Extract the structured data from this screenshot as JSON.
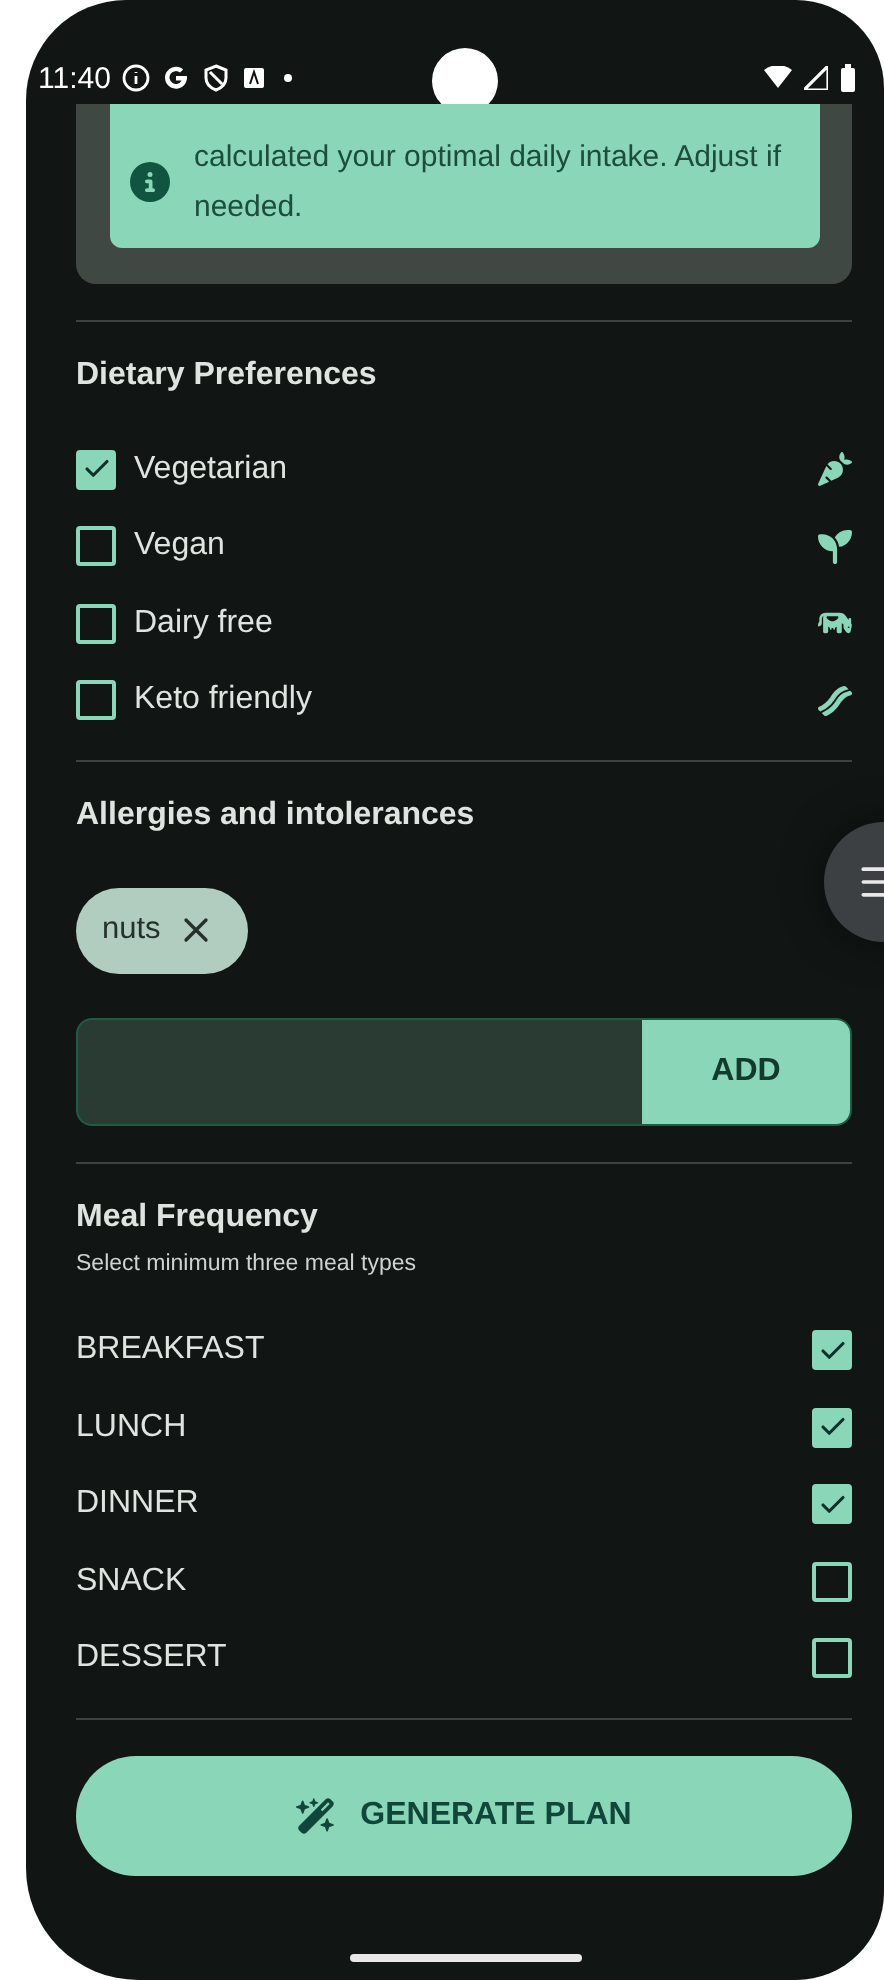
{
  "status_bar": {
    "time": "11:40"
  },
  "info_card": {
    "text": "calculated your optimal daily intake. Adjust if needed."
  },
  "dietary_preferences": {
    "title": "Dietary Preferences",
    "items": [
      {
        "label": "Vegetarian",
        "checked": true
      },
      {
        "label": "Vegan",
        "checked": false
      },
      {
        "label": "Dairy free",
        "checked": false
      },
      {
        "label": "Keto friendly",
        "checked": false
      }
    ]
  },
  "allergies": {
    "title": "Allergies and intolerances",
    "chips": [
      {
        "label": "nuts"
      }
    ],
    "add_button": "ADD"
  },
  "meal_frequency": {
    "title": "Meal Frequency",
    "subtitle": "Select minimum three meal types",
    "items": [
      {
        "label": "BREAKFAST",
        "checked": true
      },
      {
        "label": "LUNCH",
        "checked": true
      },
      {
        "label": "DINNER",
        "checked": true
      },
      {
        "label": "SNACK",
        "checked": false
      },
      {
        "label": "DESSERT",
        "checked": false
      }
    ]
  },
  "generate_button": "GENERATE PLAN"
}
